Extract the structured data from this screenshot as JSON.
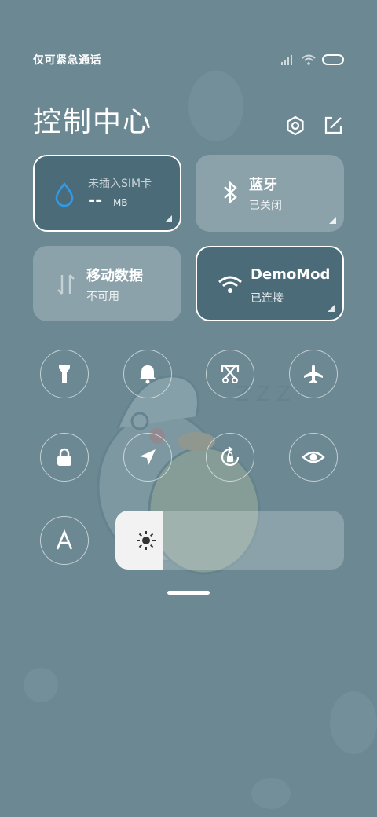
{
  "status": {
    "carrier": "仅可紧急通话"
  },
  "title": "控制中心",
  "cards": {
    "data_usage": {
      "line1": "未插入SIM卡",
      "value": "--",
      "unit": "MB"
    },
    "bluetooth": {
      "label": "蓝牙",
      "state": "已关闭"
    },
    "mobile_data": {
      "label": "移动数据",
      "state": "不可用"
    },
    "wifi": {
      "label": "DemoMod",
      "state": "已连接"
    }
  },
  "toggles": {
    "row1": [
      "flashlight-icon",
      "bell-icon",
      "screenshot-icon",
      "airplane-icon"
    ],
    "row2": [
      "lock-icon",
      "location-icon",
      "rotation-lock-icon",
      "eye-icon"
    ],
    "row3": [
      "font-size-icon"
    ]
  },
  "brightness": {
    "level": 0.21
  },
  "colors": {
    "background": "#6b8893",
    "active_card": "#4b6b79",
    "accent_blue": "#2f9be8"
  }
}
